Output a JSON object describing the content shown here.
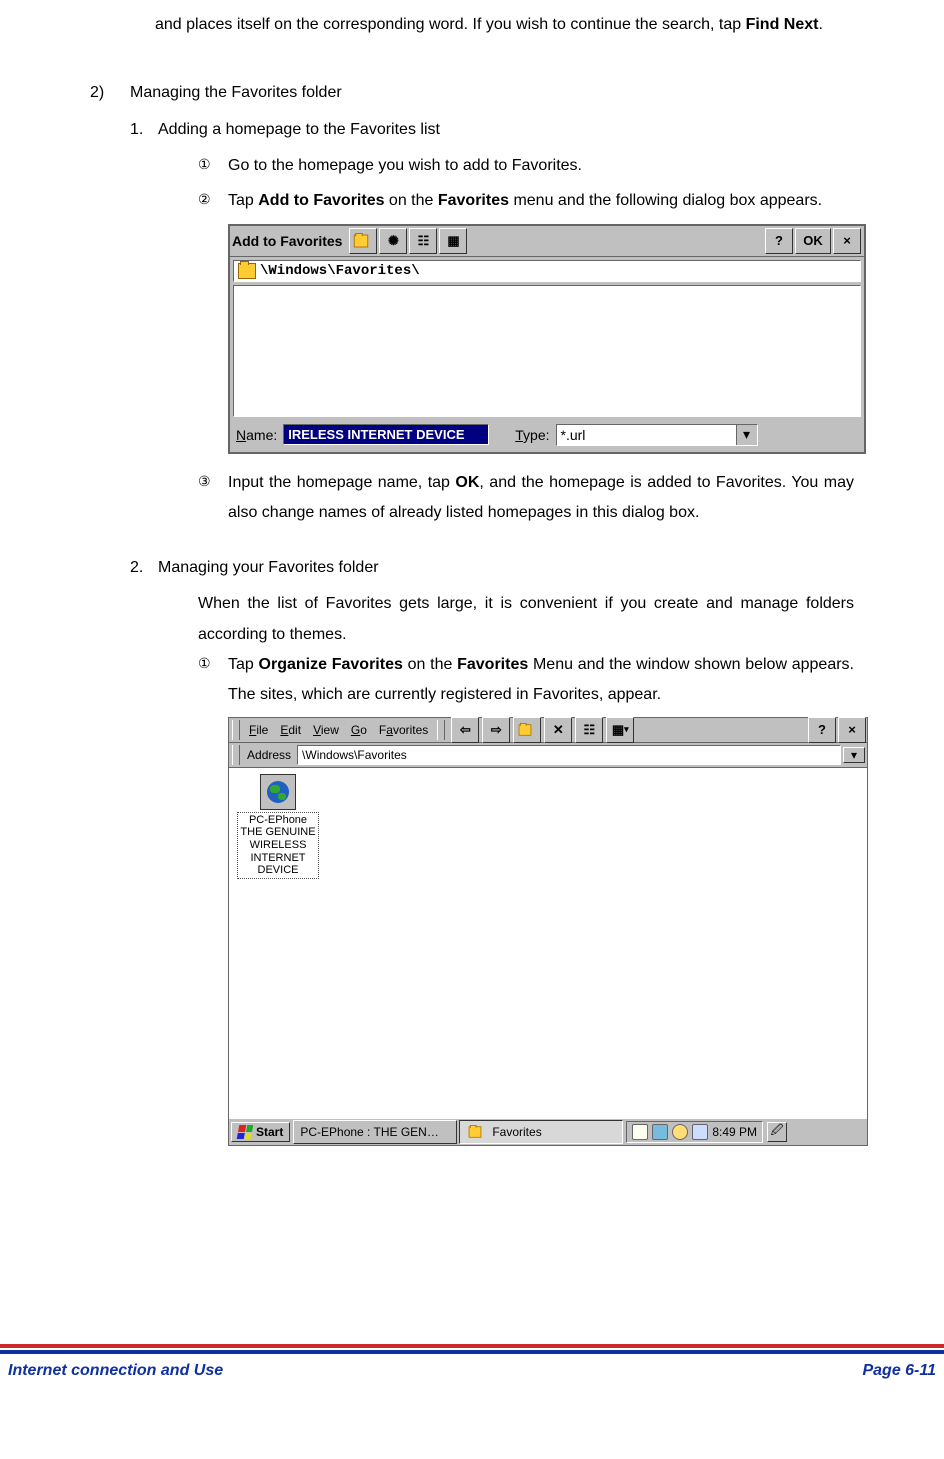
{
  "intro": {
    "line1": "and places itself on the corresponding word. If you wish to continue the search, tap ",
    "findnext": "Find Next",
    "period": "."
  },
  "sec2": {
    "num": "2)",
    "title": "Managing the Favorites folder"
  },
  "sub1": {
    "num": "1.",
    "title": "Adding a homepage to the Favorites list"
  },
  "step1": {
    "num": "①",
    "text": "Go to the homepage you wish to add to Favorites."
  },
  "step2": {
    "num": "②",
    "pre": "Tap ",
    "b1": "Add to Favorites",
    "mid": " on the ",
    "b2": "Favorites",
    "post": " menu and the following dialog box appears."
  },
  "dialog1": {
    "title": "Add to Favorites",
    "path": "\\Windows\\Favorites\\",
    "name_label_u": "N",
    "name_label_rest": "ame:",
    "name_value": "IRELESS INTERNET DEVICE",
    "type_label_u": "T",
    "type_label_rest": "ype:",
    "type_value": "*.url",
    "help": "?",
    "ok": "OK",
    "close": "×"
  },
  "step3": {
    "num": "③",
    "pre": "Input the homepage name, tap ",
    "b1": "OK",
    "post": ", and the homepage is added to Favorites. You may also change names of already listed homepages in this dialog box."
  },
  "sub2": {
    "num": "2.",
    "title": "Managing your Favorites folder",
    "body": "When the list of Favorites gets large, it is convenient if you create and manage folders according to themes."
  },
  "step2_1": {
    "num": "①",
    "pre": "Tap ",
    "b1": "Organize Favorites",
    "mid": " on the ",
    "b2": "Favorites",
    "post": " Menu and the window shown below appears. The sites, which are currently registered in Favorites, appear."
  },
  "explorer": {
    "menu": {
      "file_u": "F",
      "file": "ile",
      "edit_u": "E",
      "edit": "dit",
      "view_u": "V",
      "view": "iew",
      "go_u": "G",
      "go": "o",
      "fav": "F",
      "fav_u": "a",
      "fav2": "vorites"
    },
    "toolbar": {
      "back": "⇦",
      "fwd": "⇨",
      "up": "📁",
      "del": "✕",
      "prop": "☷",
      "views": "▦",
      "dd": "▾",
      "help": "?",
      "close": "×"
    },
    "addr_label_u": "A",
    "addr_label_rest": "ddress",
    "addr_value": "\\Windows\\Favorites",
    "icon_label": "PC-EPhone THE GENUINE WIRELESS INTERNET DEVICE",
    "taskbar": {
      "start": "Start",
      "task1": "PC-EPhone : THE GEN…",
      "task2": "Favorites",
      "time": "8:49 PM"
    }
  },
  "footer": {
    "left": "Internet connection and Use",
    "right": "Page 6-11"
  }
}
